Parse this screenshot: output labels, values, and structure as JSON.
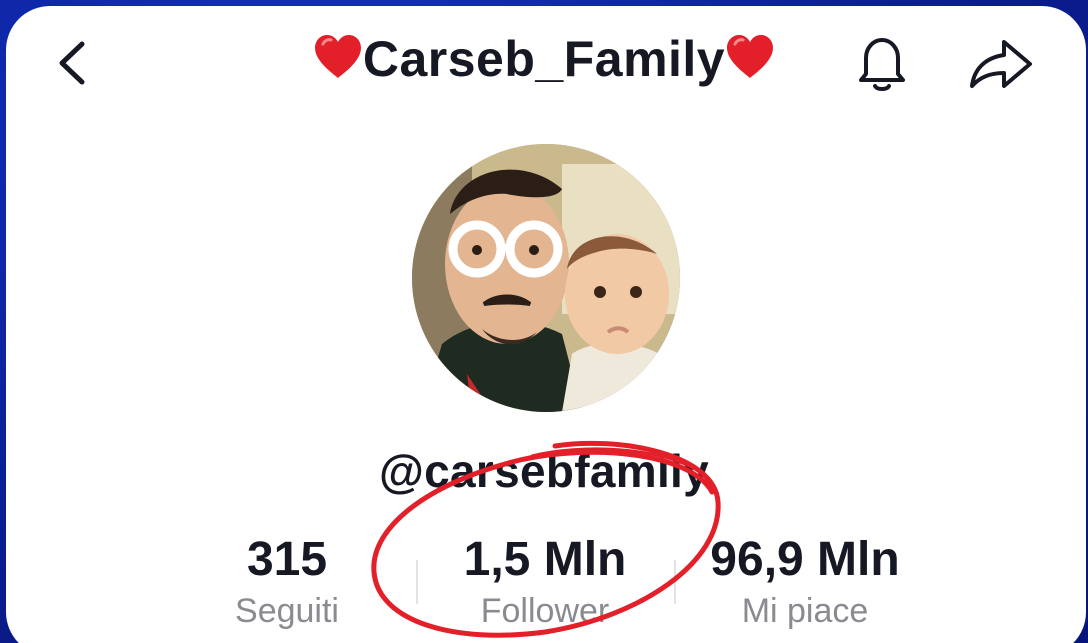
{
  "header": {
    "title": "Carseb_Family",
    "back_icon": "chevron-left-icon",
    "bell_icon": "bell-icon",
    "share_icon": "share-icon",
    "heart_color": "#e3202a"
  },
  "profile": {
    "avatar": "profile-avatar",
    "username": "@carsebfamily"
  },
  "stats": [
    {
      "value": "315",
      "label": "Seguiti"
    },
    {
      "value": "1,5 Mln",
      "label": "Follower"
    },
    {
      "value": "96,9 Mln",
      "label": "Mi piace"
    }
  ],
  "annotation": {
    "color": "#e3202a",
    "shape": "hand-drawn-ellipse"
  },
  "colors": {
    "background": "#0b1f95",
    "text": "#161823",
    "muted": "#8a8b91"
  }
}
